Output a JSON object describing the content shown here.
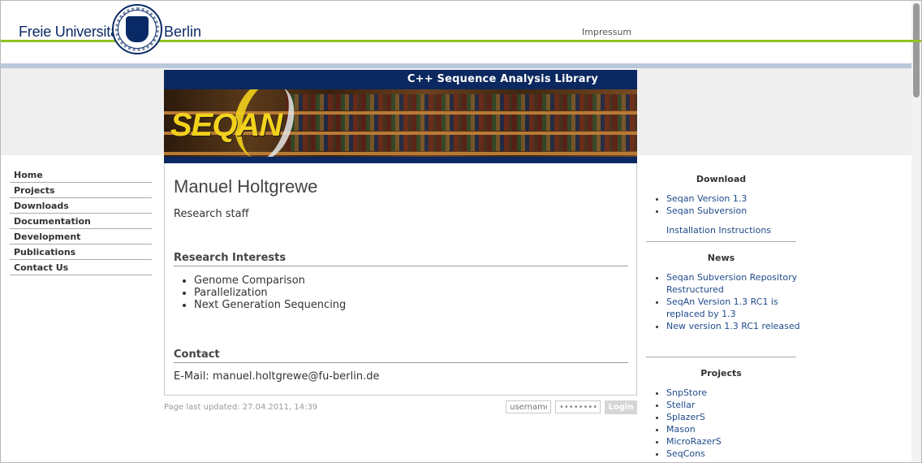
{
  "header": {
    "university_name": "Freie Universität",
    "university_city": "Berlin",
    "impressum_link": "Impressum"
  },
  "banner": {
    "tagline": "C++ Sequence Analysis Library",
    "logo": "SEQAN"
  },
  "nav": {
    "items": [
      {
        "label": "Home"
      },
      {
        "label": "Projects"
      },
      {
        "label": "Downloads"
      },
      {
        "label": "Documentation"
      },
      {
        "label": "Development"
      },
      {
        "label": "Publications"
      },
      {
        "label": "Contact Us"
      }
    ]
  },
  "main": {
    "name": "Manuel Holtgrewe",
    "role": "Research staff",
    "interests_heading": "Research Interests",
    "interests": [
      "Genome Comparison",
      "Parallelization",
      "Next Generation Sequencing"
    ],
    "contact_heading": "Contact",
    "contact_email": "E-Mail: manuel.holtgrewe@fu-berlin.de"
  },
  "footer": {
    "updated": "Page last updated: 27.04.2011, 14:39",
    "username_placeholder": "username",
    "password_value": "••••••••",
    "login_label": "Login"
  },
  "sidebar": {
    "download_title": "Download",
    "download_links": [
      "Seqan Version 1.3",
      "Seqan Subversion"
    ],
    "install_link": "Installation Instructions",
    "news_title": "News",
    "news_links": [
      "Seqan Subversion Repository Restructured",
      "SeqAn Version 1.3 RC1 is replaced by 1.3",
      "New version 1.3 RC1 released"
    ],
    "projects_title": "Projects",
    "project_links": [
      "SnpStore",
      "Stellar",
      "SplazerS",
      "Mason",
      "MicroRazerS",
      "SeqCons"
    ]
  }
}
